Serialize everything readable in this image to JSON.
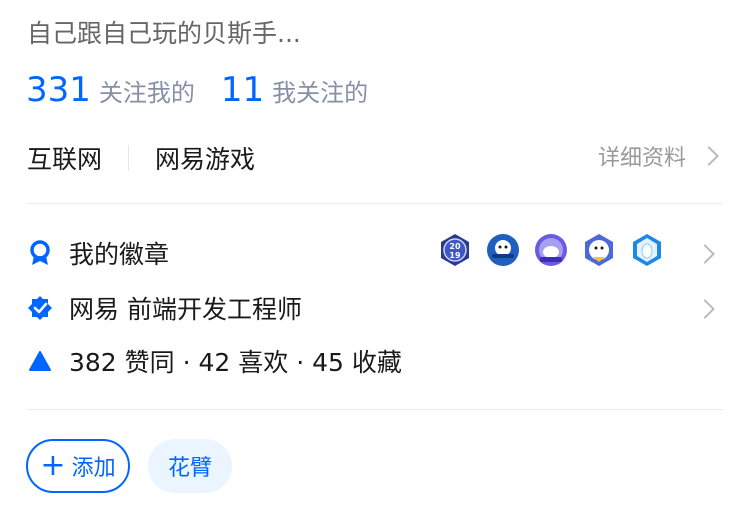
{
  "headline": "自己跟自己玩的贝斯手...",
  "stats": {
    "followers_count": "331",
    "followers_label": "关注我的",
    "following_count": "11",
    "following_label": "我关注的"
  },
  "business": {
    "industry": "互联网",
    "company": "网易游戏",
    "detail_link": "详细资料"
  },
  "badges_row": {
    "label": "我的徽章",
    "icons": [
      "badge-2019-icon",
      "badge-mascot-icon",
      "badge-unicorn-icon",
      "badge-bird-icon",
      "badge-hexagon-icon"
    ]
  },
  "certification": {
    "label": "网易 前端开发工程师"
  },
  "achievements": {
    "text": "382 赞同 · 42 喜欢 · 45 收藏"
  },
  "actions": {
    "add_label": "添加",
    "tag_label": "花臂"
  },
  "colors": {
    "accent": "#0066ff",
    "secondary_text": "#8590a6"
  }
}
